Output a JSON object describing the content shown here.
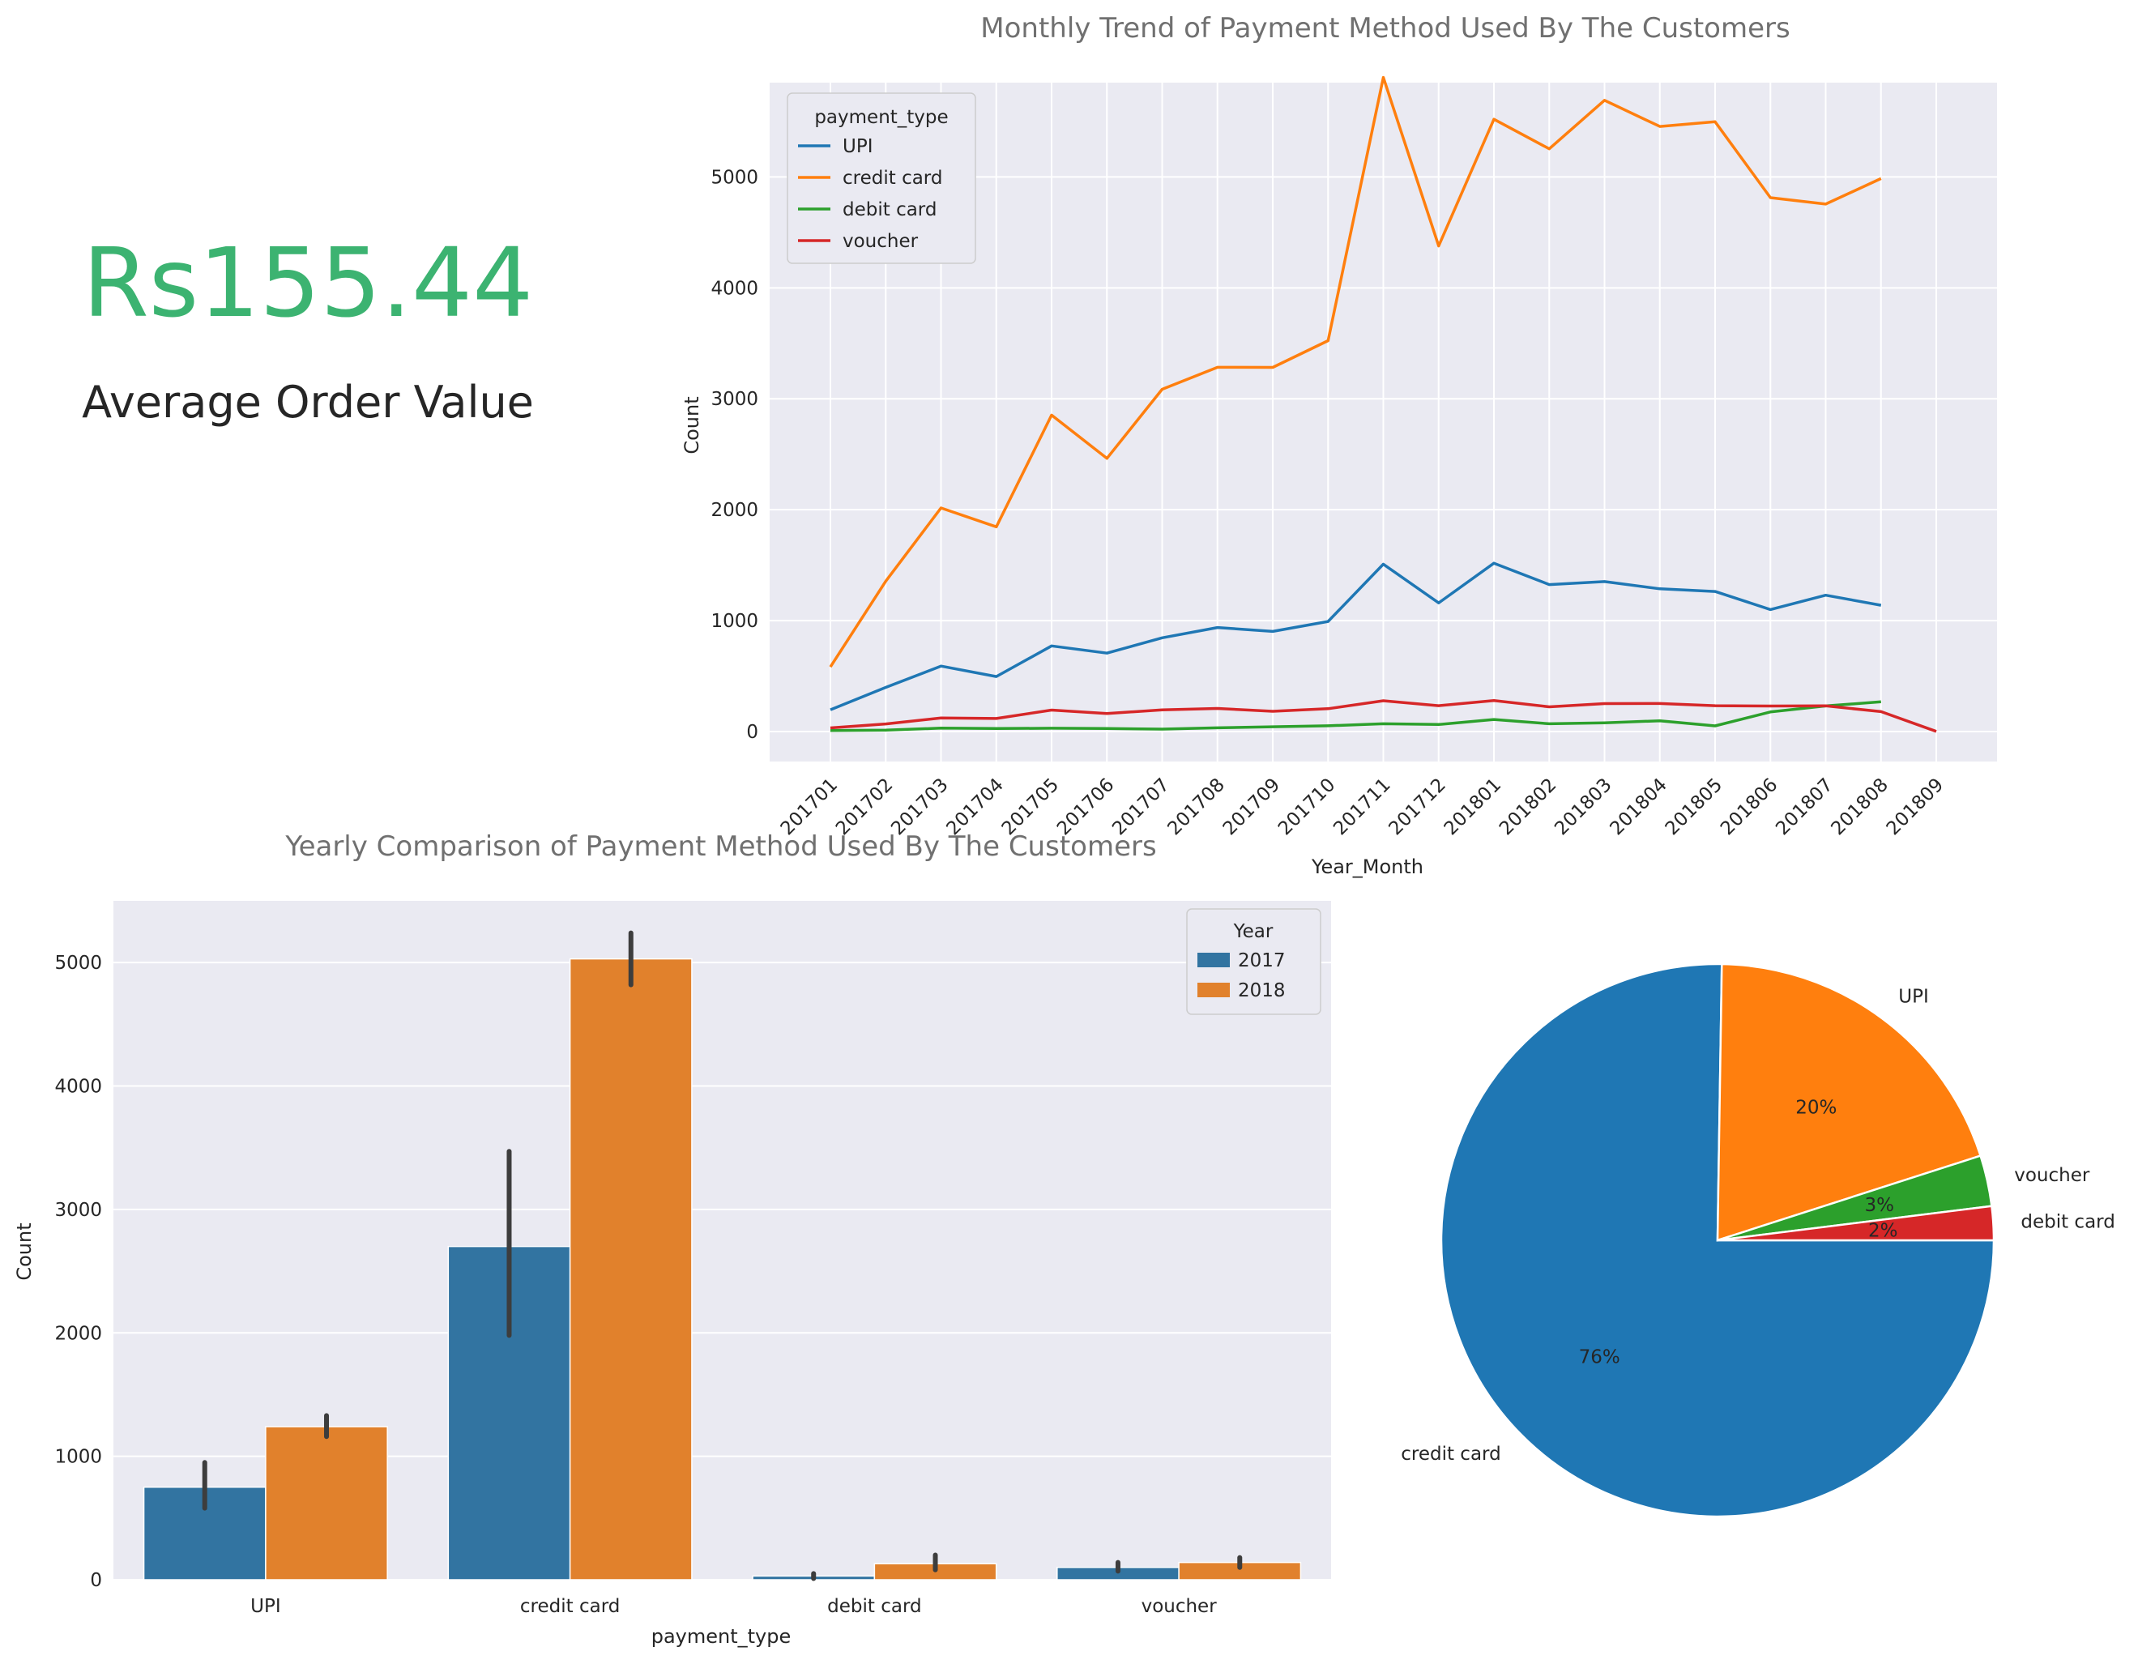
{
  "kpi": {
    "value": "Rs155.44",
    "label": "Average Order Value"
  },
  "colors": {
    "UPI": "#1f77b4",
    "credit card": "#ff7f0e",
    "debit card": "#2ca02c",
    "voucher": "#d62728",
    "bar_2017": "#3274a1",
    "bar_2018": "#e1812c",
    "panel_bg": "#eaeaf2",
    "grid": "#ffffff",
    "title": "#707070",
    "text": "#262626",
    "kpi": "#3cb371"
  },
  "chart_data": [
    {
      "type": "line",
      "title": "Monthly Trend of Payment Method Used By The Customers",
      "xlabel": "Year_Month",
      "ylabel": "Count",
      "ylim": [
        -270,
        5850
      ],
      "yticks": [
        0,
        1000,
        2000,
        3000,
        4000,
        5000
      ],
      "grid": true,
      "legend_title": "payment_type",
      "legend_position": "upper left",
      "x": [
        "201701",
        "201702",
        "201703",
        "201704",
        "201705",
        "201706",
        "201707",
        "201708",
        "201709",
        "201710",
        "201711",
        "201712",
        "201801",
        "201802",
        "201803",
        "201804",
        "201805",
        "201806",
        "201807",
        "201808",
        "201809"
      ],
      "series": [
        {
          "name": "UPI",
          "values": [
            197,
            398,
            590,
            496,
            772,
            707,
            845,
            938,
            903,
            993,
            1509,
            1160,
            1518,
            1325,
            1352,
            1287,
            1263,
            1100,
            1229,
            1139,
            null
          ]
        },
        {
          "name": "credit card",
          "values": [
            583,
            1356,
            2016,
            1846,
            2853,
            2463,
            3086,
            3284,
            3283,
            3524,
            5897,
            4378,
            5520,
            5253,
            5691,
            5455,
            5497,
            4813,
            4755,
            4985,
            null
          ]
        },
        {
          "name": "debit card",
          "values": [
            9,
            13,
            31,
            27,
            30,
            27,
            22,
            34,
            43,
            52,
            70,
            64,
            109,
            70,
            78,
            97,
            51,
            177,
            231,
            268,
            null
          ]
        },
        {
          "name": "voucher",
          "values": [
            33,
            69,
            123,
            118,
            194,
            162,
            196,
            208,
            183,
            206,
            278,
            233,
            279,
            223,
            252,
            253,
            233,
            230,
            232,
            180,
            2
          ]
        }
      ]
    },
    {
      "type": "bar",
      "title": "Yearly Comparison of Payment Method Used By The Customers",
      "xlabel": "payment_type",
      "ylabel": "Count",
      "ylim": [
        0,
        5500
      ],
      "yticks": [
        0,
        1000,
        2000,
        3000,
        4000,
        5000
      ],
      "grid": true,
      "legend_title": "Year",
      "legend_position": "upper right",
      "categories": [
        "UPI",
        "credit card",
        "debit card",
        "voucher"
      ],
      "series": [
        {
          "name": "2017",
          "values": [
            750,
            2700,
            30,
            100
          ],
          "ci_low": [
            580,
            1980,
            10,
            70
          ],
          "ci_high": [
            950,
            3470,
            50,
            140
          ]
        },
        {
          "name": "2018",
          "values": [
            1240,
            5030,
            130,
            140
          ],
          "ci_low": [
            1160,
            4820,
            80,
            100
          ],
          "ci_high": [
            1330,
            5240,
            200,
            180
          ]
        }
      ]
    },
    {
      "type": "pie",
      "labels": [
        "credit card",
        "UPI",
        "voucher",
        "debit card"
      ],
      "values": [
        76,
        20,
        3,
        2
      ],
      "autopct": [
        "76%",
        "20%",
        "3%",
        "2%"
      ],
      "colors": [
        "#1f77b4",
        "#ff7f0e",
        "#2ca02c",
        "#d62728"
      ]
    }
  ]
}
